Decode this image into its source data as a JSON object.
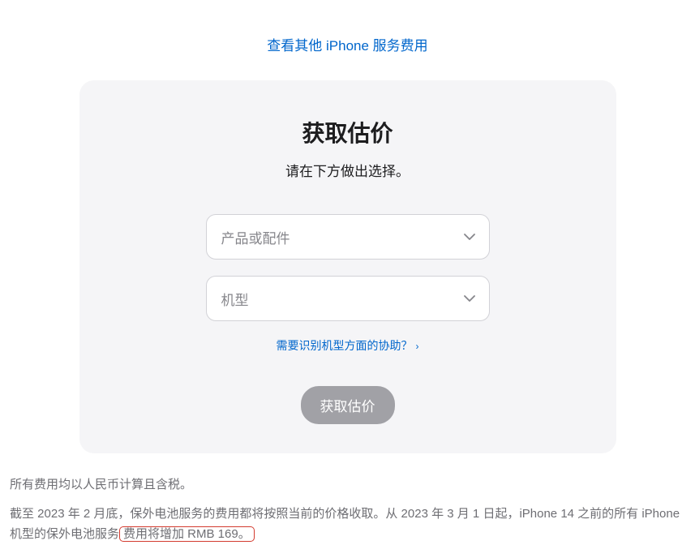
{
  "topLink": "查看其他 iPhone 服务费用",
  "card": {
    "title": "获取估价",
    "subtitle": "请在下方做出选择。",
    "select1": "产品或配件",
    "select2": "机型",
    "helpLink": "需要识别机型方面的协助？",
    "button": "获取估价"
  },
  "footer": {
    "line1": "所有费用均以人民币计算且含税。",
    "line2_part1": "截至 2023 年 2 月底，保外电池服务的费用都将按照当前的价格收取。从 2023 年 3 月 1 日起，iPhone 14 之前的所有 iPhone 机型的保外电池服务",
    "line2_highlight": "费用将增加 RMB 169。"
  }
}
